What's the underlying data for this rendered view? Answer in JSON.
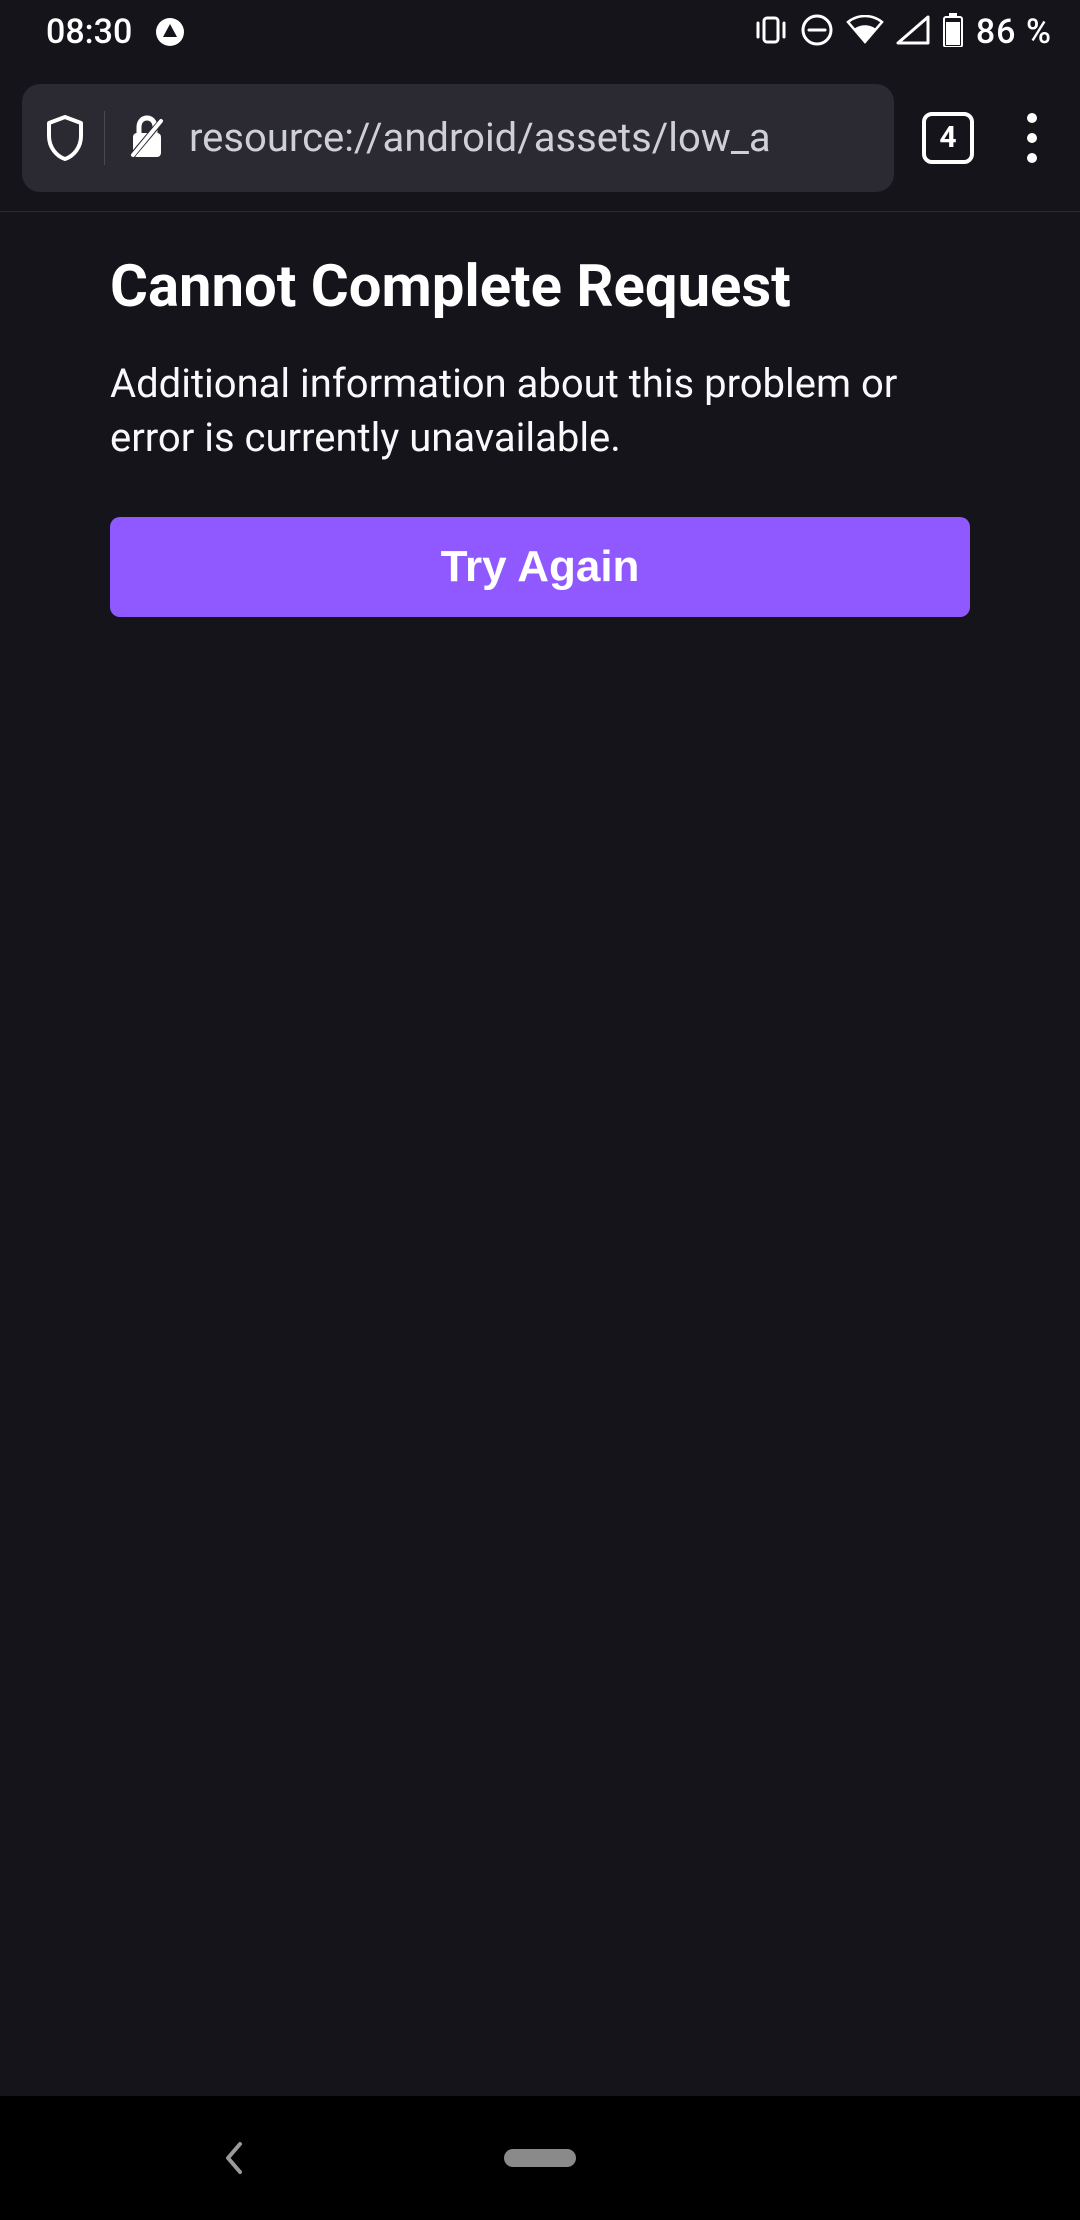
{
  "status_bar": {
    "clock": "08:30",
    "battery_percent": "86 %"
  },
  "browser": {
    "url": "resource://android/assets/low_a",
    "tab_count": "4"
  },
  "error_page": {
    "title": "Cannot Complete Request",
    "message": "Additional information about this problem or error is currently unavailable.",
    "retry_label": "Try Again"
  },
  "colors": {
    "accent": "#9059ff",
    "background": "#15141a",
    "surface": "#2b2a33"
  }
}
